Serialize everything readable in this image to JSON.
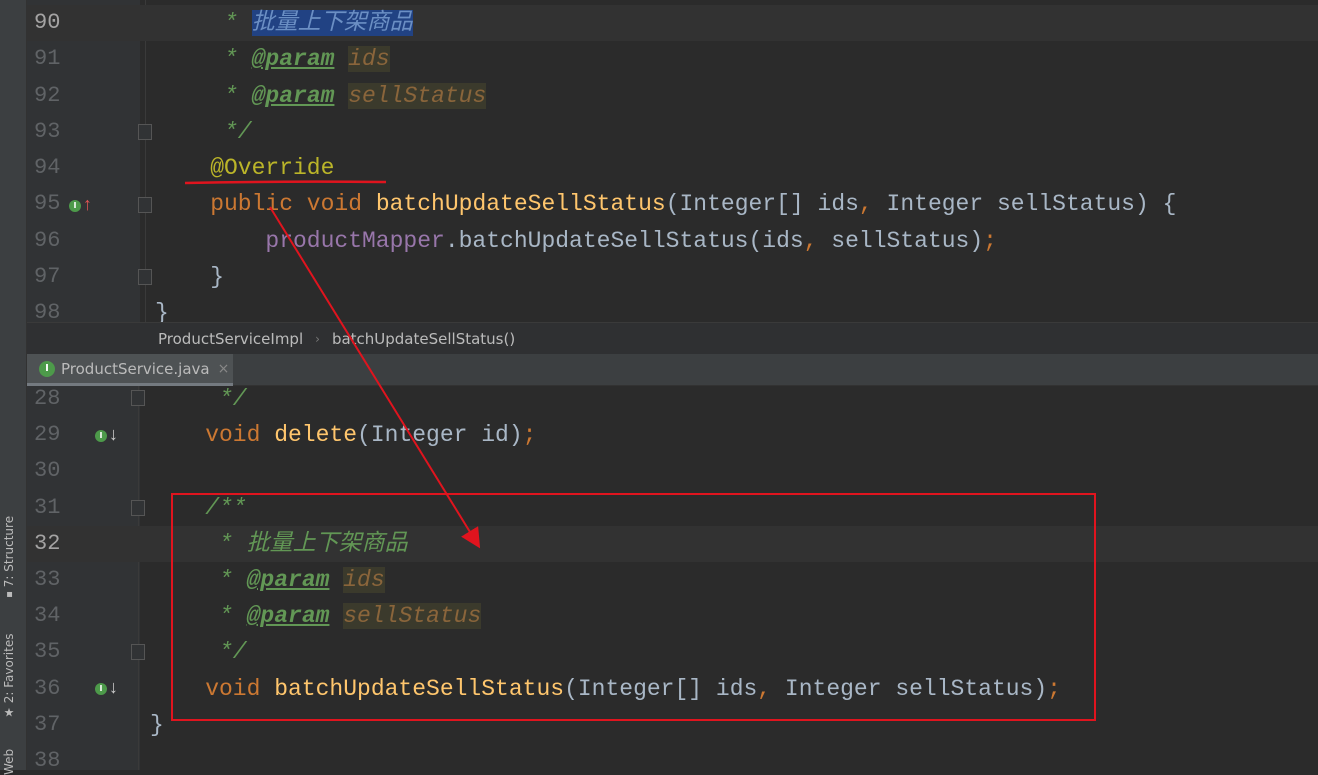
{
  "tool_strip": {
    "structure": "7: Structure",
    "favorites": "2: Favorites",
    "web": "Web"
  },
  "breadcrumb": {
    "items": [
      "ProductServiceImpl",
      "batchUpdateSellStatus()"
    ],
    "separator": "›"
  },
  "tab": {
    "label": "ProductService.java",
    "icon": "I",
    "close": "×"
  },
  "top": {
    "current_line": 90,
    "lines": [
      {
        "n": "90",
        "indent": 5,
        "tokens": [
          [
            "doc",
            "* "
          ],
          [
            "sel",
            "批量上下架商品"
          ]
        ]
      },
      {
        "n": "91",
        "indent": 5,
        "tokens": [
          [
            "doc",
            "* "
          ],
          [
            "tag",
            "@param"
          ],
          [
            "doc",
            " "
          ],
          [
            "pref",
            "ids"
          ]
        ]
      },
      {
        "n": "92",
        "indent": 5,
        "tokens": [
          [
            "doc",
            "* "
          ],
          [
            "tag",
            "@param"
          ],
          [
            "doc",
            " "
          ],
          [
            "pref",
            "sellStatus"
          ]
        ]
      },
      {
        "n": "93",
        "indent": 5,
        "tokens": [
          [
            "doc",
            "*/"
          ]
        ]
      },
      {
        "n": "94",
        "indent": 4,
        "tokens": [
          [
            "ann",
            "@Override"
          ]
        ]
      },
      {
        "n": "95",
        "indent": 4,
        "tokens": [
          [
            "kw",
            "public void "
          ],
          [
            "fn",
            "batchUpdateSellStatus"
          ],
          [
            "plain",
            "(Integer[] ids"
          ],
          [
            "kw",
            ", "
          ],
          [
            "plain",
            "Integer sellStatus) {"
          ]
        ]
      },
      {
        "n": "96",
        "indent": 8,
        "tokens": [
          [
            "field",
            "productMapper"
          ],
          [
            "plain",
            ".batchUpdateSellStatus(ids"
          ],
          [
            "kw",
            ", "
          ],
          [
            "plain",
            "sellStatus)"
          ],
          [
            "kw",
            ";"
          ]
        ]
      },
      {
        "n": "97",
        "indent": 4,
        "tokens": [
          [
            "plain",
            "}"
          ]
        ]
      },
      {
        "n": "98",
        "indent": 0,
        "tokens": [
          [
            "plain",
            "}"
          ]
        ]
      }
    ]
  },
  "bottom": {
    "current_line": 32,
    "lines": [
      {
        "n": "28",
        "indent": 5,
        "tokens": [
          [
            "doc",
            "*/"
          ]
        ]
      },
      {
        "n": "29",
        "indent": 4,
        "tokens": [
          [
            "kw",
            "void "
          ],
          [
            "fn",
            "delete"
          ],
          [
            "plain",
            "(Integer id)"
          ],
          [
            "kw",
            ";"
          ]
        ]
      },
      {
        "n": "30",
        "indent": 0,
        "tokens": []
      },
      {
        "n": "31",
        "indent": 4,
        "tokens": [
          [
            "doc",
            "/**"
          ]
        ]
      },
      {
        "n": "32",
        "indent": 5,
        "tokens": [
          [
            "doc",
            "* 批量上下架商品"
          ]
        ]
      },
      {
        "n": "33",
        "indent": 5,
        "tokens": [
          [
            "doc",
            "* "
          ],
          [
            "tag",
            "@param"
          ],
          [
            "doc",
            " "
          ],
          [
            "pref",
            "ids"
          ]
        ]
      },
      {
        "n": "34",
        "indent": 5,
        "tokens": [
          [
            "doc",
            "* "
          ],
          [
            "tag",
            "@param"
          ],
          [
            "doc",
            " "
          ],
          [
            "pref",
            "sellStatus"
          ]
        ]
      },
      {
        "n": "35",
        "indent": 5,
        "tokens": [
          [
            "doc",
            "*/"
          ]
        ]
      },
      {
        "n": "36",
        "indent": 4,
        "tokens": [
          [
            "kw",
            "void "
          ],
          [
            "fn",
            "batchUpdateSellStatus"
          ],
          [
            "plain",
            "(Integer[] ids"
          ],
          [
            "kw",
            ", "
          ],
          [
            "plain",
            "Integer sellStatus)"
          ],
          [
            "kw",
            ";"
          ]
        ]
      },
      {
        "n": "37",
        "indent": 0,
        "tokens": [
          [
            "plain",
            "}"
          ]
        ]
      },
      {
        "n": "38",
        "indent": 0,
        "tokens": []
      }
    ]
  },
  "colors": {
    "annotation_red": "#e0141e",
    "keyword": "#cc7832",
    "method": "#ffc66d",
    "doc": "#629755"
  }
}
